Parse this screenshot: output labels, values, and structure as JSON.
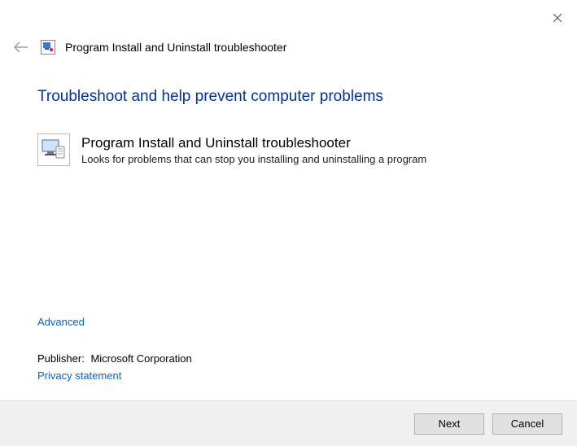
{
  "window": {
    "title": "Program Install and Uninstall troubleshooter"
  },
  "content": {
    "heading": "Troubleshoot and help prevent computer problems",
    "troubleshooter": {
      "title": "Program Install and Uninstall troubleshooter",
      "description": "Looks for problems that can stop you installing and uninstalling a program"
    },
    "advanced_link": "Advanced",
    "publisher_label": "Publisher:",
    "publisher_name": "Microsoft Corporation",
    "privacy_link": "Privacy statement"
  },
  "footer": {
    "next_label": "Next",
    "cancel_label": "Cancel"
  },
  "icons": {
    "back": "back-arrow-icon",
    "close": "close-icon",
    "app": "troubleshooter-icon",
    "monitor": "monitor-icon"
  }
}
